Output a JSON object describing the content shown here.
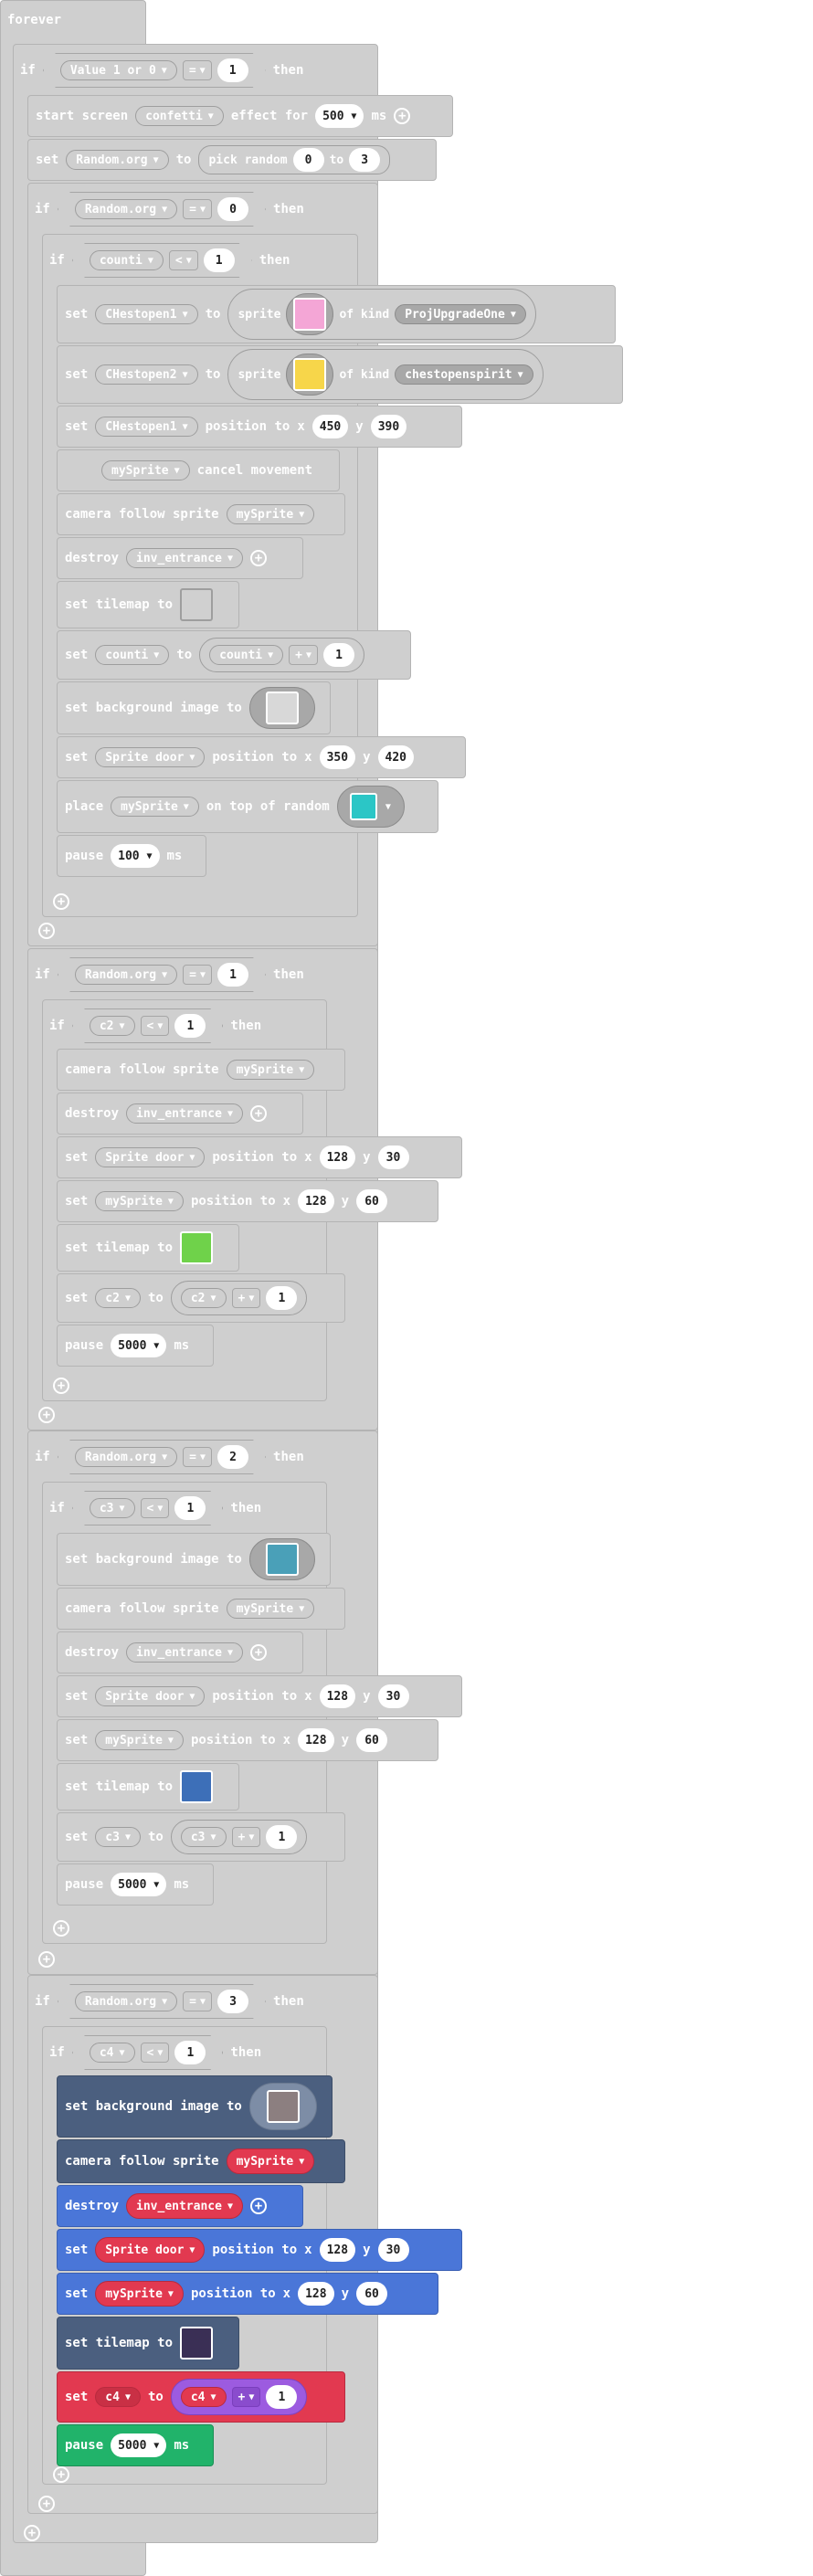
{
  "forever_label": "forever",
  "if_label": "if",
  "then_label": "then",
  "set_label": "set",
  "to_label": "to",
  "x_label": "x",
  "y_label": "y",
  "ms_label": "ms",
  "position_to_label": "position to",
  "of_kind_label": "of kind",
  "sprite_label": "sprite",
  "camera_follow_label": "camera follow sprite",
  "destroy_label": "destroy",
  "set_tilemap_label": "set tilemap to",
  "set_background_label": "set background image to",
  "pause_label": "pause",
  "start_screen": {
    "label1": "start screen",
    "effect": "confetti",
    "label2": "effect for",
    "duration": "500",
    "unit": "ms"
  },
  "top_if": {
    "var": "Value 1 or 0",
    "op": "=",
    "value": "1"
  },
  "random_set": {
    "var": "Random.org",
    "label": "pick random",
    "from": "0",
    "to_word": "to",
    "to": "3"
  },
  "branches": [
    {
      "var": "Random.org",
      "op": "=",
      "value": "0",
      "inner_var": "counti",
      "inner_op": "<",
      "inner_value": "1"
    },
    {
      "var": "Random.org",
      "op": "=",
      "value": "1",
      "inner_var": "c2",
      "inner_op": "<",
      "inner_value": "1"
    },
    {
      "var": "Random.org",
      "op": "=",
      "value": "2",
      "inner_var": "c3",
      "inner_op": "<",
      "inner_value": "1"
    },
    {
      "var": "Random.org",
      "op": "=",
      "value": "3",
      "inner_var": "c4",
      "inner_op": "<",
      "inner_value": "1"
    }
  ],
  "b0": {
    "chest1": "CHestopen1",
    "chest1_kind": "ProjUpgradeOne",
    "chest2": "CHestopen2",
    "chest2_kind": "chestopenspirit",
    "chest1_x": "450",
    "chest1_y": "390",
    "my_sprite": "mySprite",
    "cancel": "cancel movement",
    "entrance": "inv_entrance",
    "counti_op": "+",
    "counti_add": "1",
    "door": "Sprite door",
    "door_x": "350",
    "door_y": "420",
    "place_label": "place",
    "on_top_label": "on top of random",
    "pause_ms": "100"
  },
  "b1": {
    "my_sprite": "mySprite",
    "entrance": "inv_entrance",
    "door": "Sprite door",
    "door_x": "128",
    "door_y": "30",
    "sprite_x": "128",
    "sprite_y": "60",
    "op": "+",
    "add": "1",
    "pause_ms": "5000"
  },
  "b2": {
    "my_sprite": "mySprite",
    "entrance": "inv_entrance",
    "door": "Sprite door",
    "door_x": "128",
    "door_y": "30",
    "sprite_x": "128",
    "sprite_y": "60",
    "op": "+",
    "add": "1",
    "pause_ms": "5000"
  },
  "b3": {
    "my_sprite": "mySprite",
    "entrance": "inv_entrance",
    "door": "Sprite door",
    "door_x": "128",
    "door_y": "30",
    "sprite_x": "128",
    "sprite_y": "60",
    "op": "+",
    "add": "1",
    "pause_ms": "5000"
  },
  "colors": {
    "disabled": "#cfcfcf",
    "scene_navy": "#4b5f7f",
    "sprites_blue": "#4a76d8",
    "variables_red": "#e23950",
    "loops_green": "#21b36a",
    "math_purple": "#9c5be0"
  }
}
